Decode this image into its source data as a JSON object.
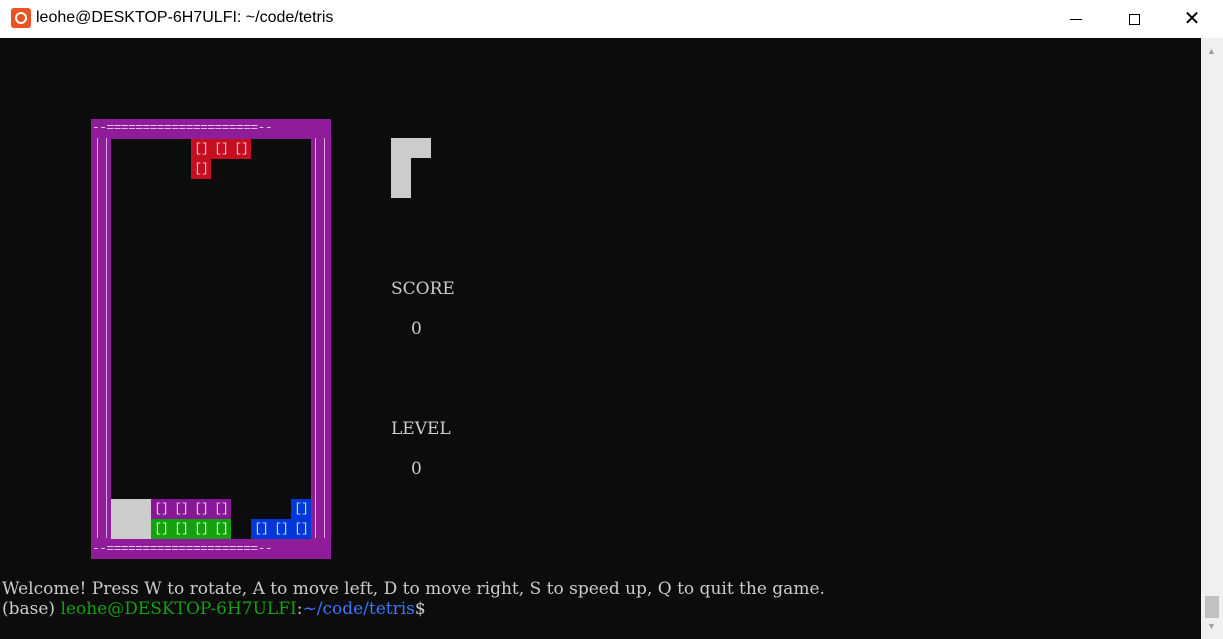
{
  "window": {
    "title": "leohe@DESKTOP-6H7ULFI: ~/code/tetris",
    "app_icon": "ubuntu-icon",
    "controls": [
      "minimize-icon",
      "maximize-icon",
      "close-icon"
    ]
  },
  "colors": {
    "terminal_bg": "#0c0c0c",
    "text": "#cccccc",
    "border": "#881798",
    "piece_red": "#c50f1f",
    "piece_purple": "#881798",
    "piece_green": "#13a10e",
    "piece_blue": "#0037da",
    "piece_gray": "#cccccc",
    "prompt_user": "#13a10e",
    "prompt_path": "#3b78ff"
  },
  "game": {
    "board_border_top": "--=====================--",
    "board_border_bottom": "--=====================--",
    "cell_glyph": "[]",
    "falling_piece": {
      "color": "red",
      "cells": [
        [
          0,
          4
        ],
        [
          0,
          5
        ],
        [
          0,
          6
        ],
        [
          1,
          4
        ]
      ]
    },
    "stack": [
      {
        "color": "gray",
        "solid": true,
        "cells": [
          [
            18,
            0
          ],
          [
            18,
            1
          ],
          [
            19,
            0
          ],
          [
            19,
            1
          ]
        ]
      },
      {
        "color": "purple",
        "cells": [
          [
            18,
            2
          ],
          [
            18,
            3
          ],
          [
            18,
            4
          ],
          [
            18,
            5
          ]
        ]
      },
      {
        "color": "green",
        "cells": [
          [
            19,
            2
          ],
          [
            19,
            3
          ],
          [
            19,
            4
          ],
          [
            19,
            5
          ]
        ]
      },
      {
        "color": "blue",
        "cells": [
          [
            18,
            9
          ],
          [
            19,
            7
          ],
          [
            19,
            8
          ],
          [
            19,
            9
          ]
        ]
      }
    ],
    "next_piece": "J",
    "score_label": "SCORE",
    "score": "0",
    "level_label": "LEVEL",
    "level": "0"
  },
  "terminal": {
    "welcome": "Welcome! Press W to rotate, A to move left, D to move right, S to speed up, Q to quit the game.",
    "prompt_env": "(base) ",
    "prompt_user": "leohe@DESKTOP-6H7ULFI",
    "prompt_sep": ":",
    "prompt_path": "~/code/tetris",
    "prompt_symbol": "$"
  }
}
